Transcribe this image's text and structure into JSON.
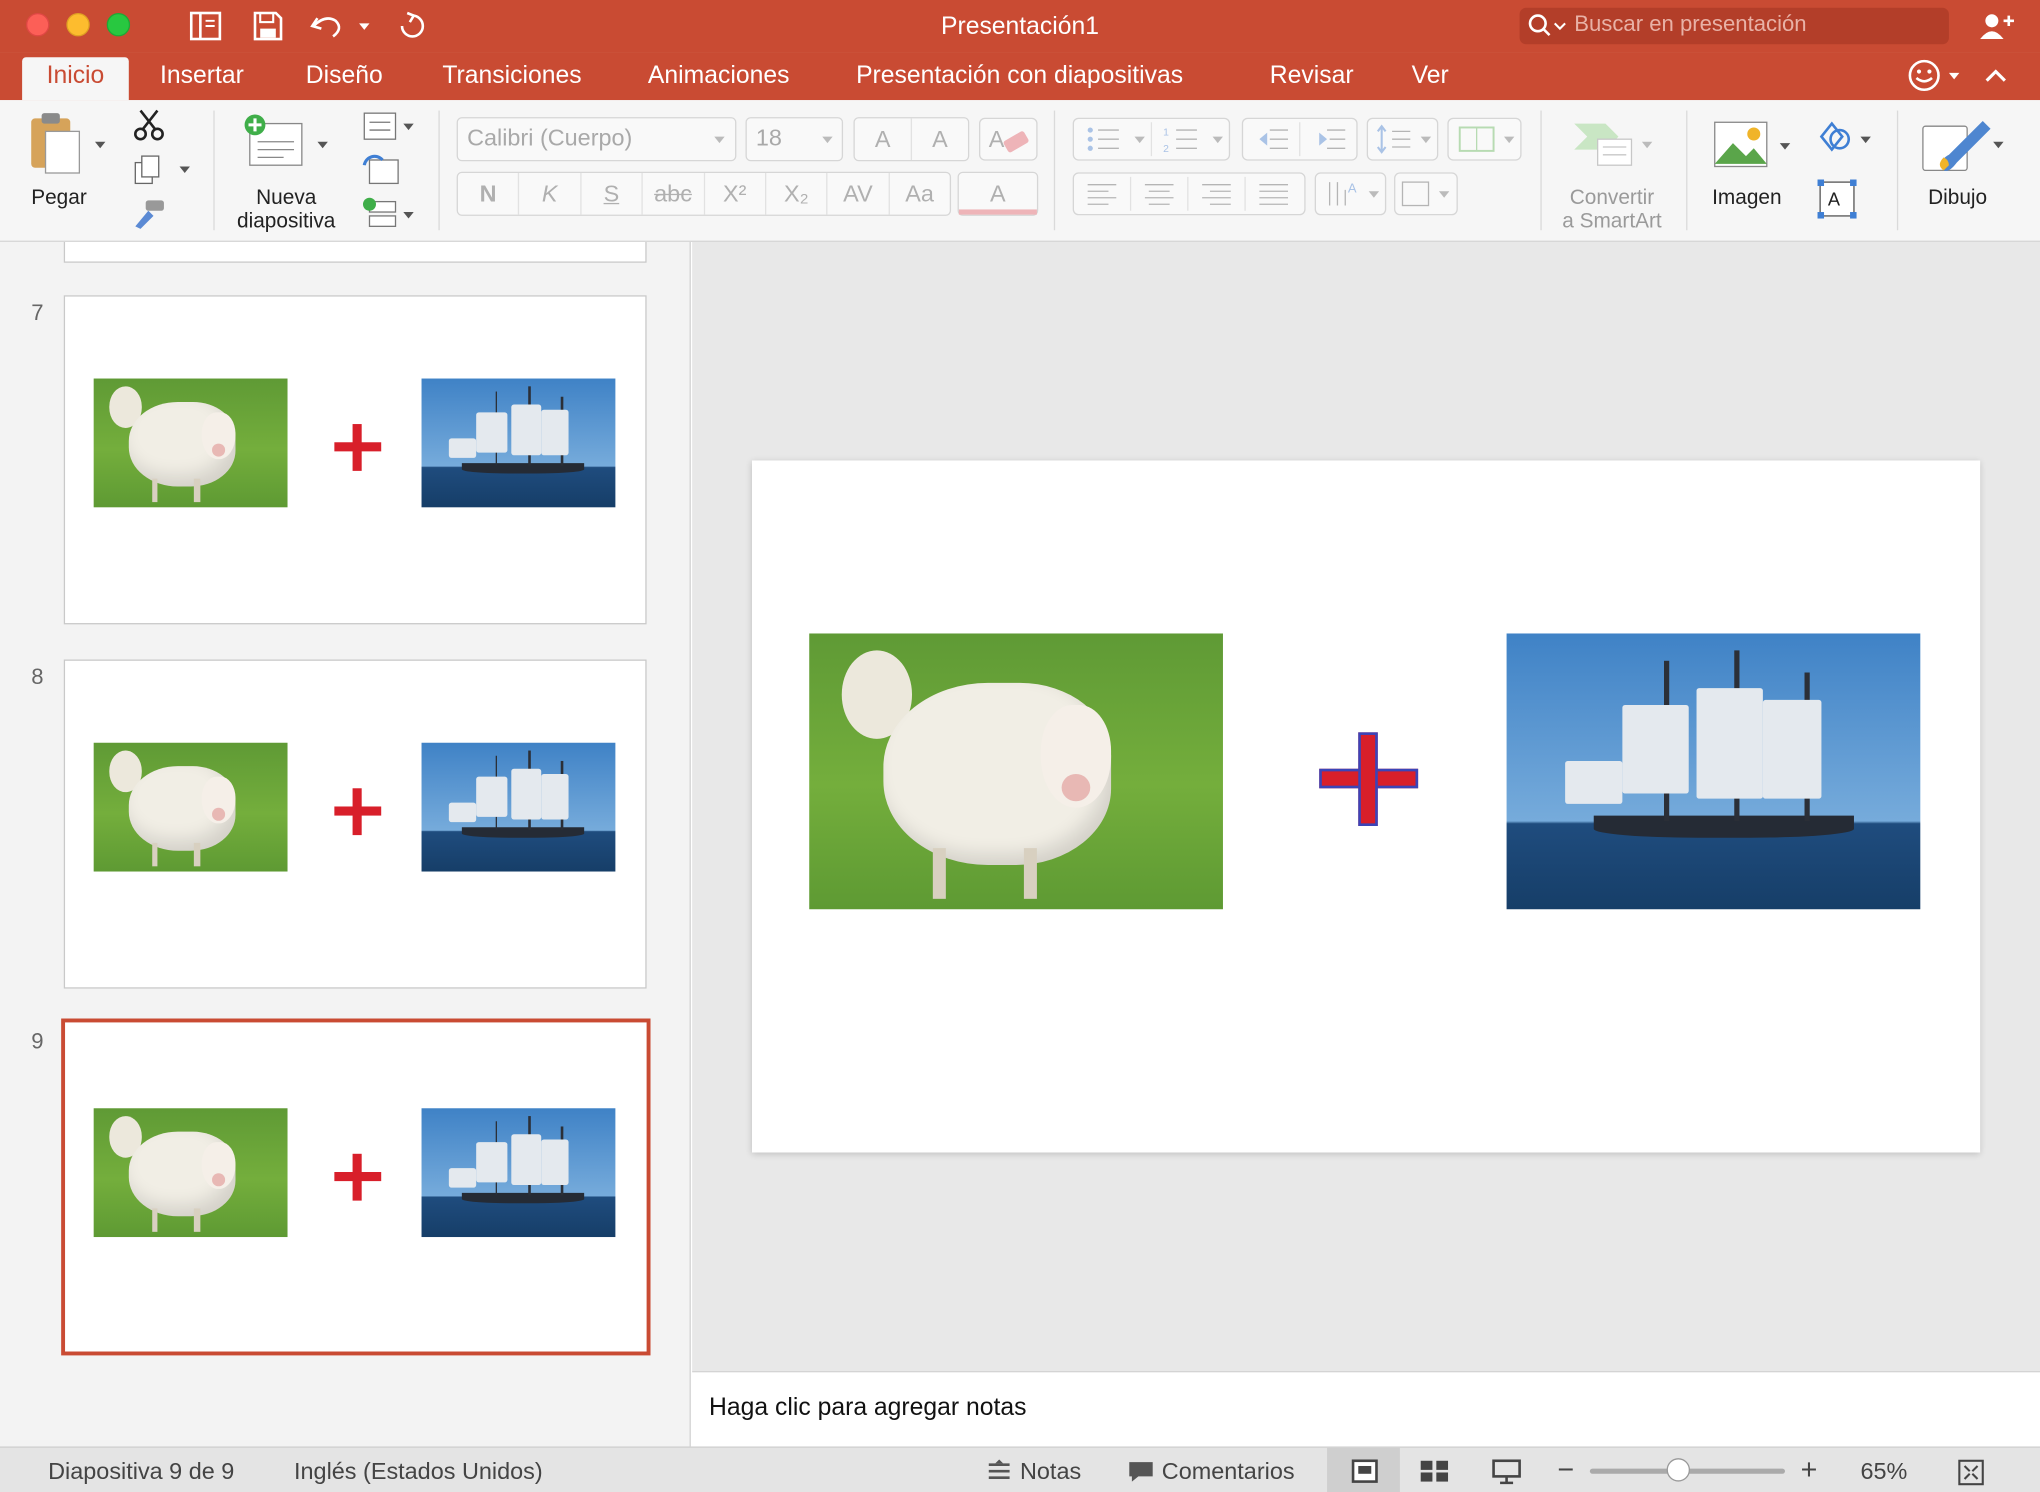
{
  "window": {
    "title": "Presentación1",
    "search_placeholder": "Buscar en presentación"
  },
  "tabs": [
    "Inicio",
    "Insertar",
    "Diseño",
    "Transiciones",
    "Animaciones",
    "Presentación con diapositivas",
    "Revisar",
    "Ver"
  ],
  "active_tab": "Inicio",
  "ribbon": {
    "paste_label": "Pegar",
    "new_slide_label_line1": "Nueva",
    "new_slide_label_line2": "diapositiva",
    "font_name": "Calibri (Cuerpo)",
    "font_size": "18",
    "bold": "N",
    "italic": "K",
    "underline": "S",
    "strikethrough": "abc",
    "superscript": "X²",
    "subscript": "X₂",
    "char_spacing": "AV",
    "change_case": "Aa",
    "grow_font": "A",
    "shrink_font": "A",
    "font_color": "A",
    "convert_label_line1": "Convertir",
    "convert_label_line2": "a SmartArt",
    "image_label": "Imagen",
    "draw_label": "Dibujo"
  },
  "slides": [
    {
      "number": "7",
      "selected": false
    },
    {
      "number": "8",
      "selected": false
    },
    {
      "number": "9",
      "selected": true
    }
  ],
  "notes_placeholder": "Haga clic para agregar notas",
  "status": {
    "slide_info": "Diapositiva 9 de 9",
    "language": "Inglés (Estados Unidos)",
    "notes_label": "Notas",
    "comments_label": "Comentarios",
    "zoom": "65%",
    "zoom_fraction": 0.45
  },
  "colors": {
    "accent": "#c94b33",
    "plus": "#d81f2a"
  },
  "icons": [
    "close-light",
    "minimize-light",
    "zoom-light",
    "sidebar-icon",
    "save-icon",
    "undo-icon",
    "redo-icon",
    "search-icon",
    "add-user-icon",
    "smiley-icon",
    "collapse-ribbon-icon",
    "cut-icon",
    "copy-icon",
    "format-painter-icon",
    "bullets-icon",
    "numbering-icon",
    "image-icon",
    "shapes-icon",
    "textbox-icon",
    "brush-icon",
    "notes-icon",
    "comments-icon",
    "normal-view-icon",
    "sorter-view-icon",
    "presenter-view-icon",
    "fit-slide-icon"
  ]
}
